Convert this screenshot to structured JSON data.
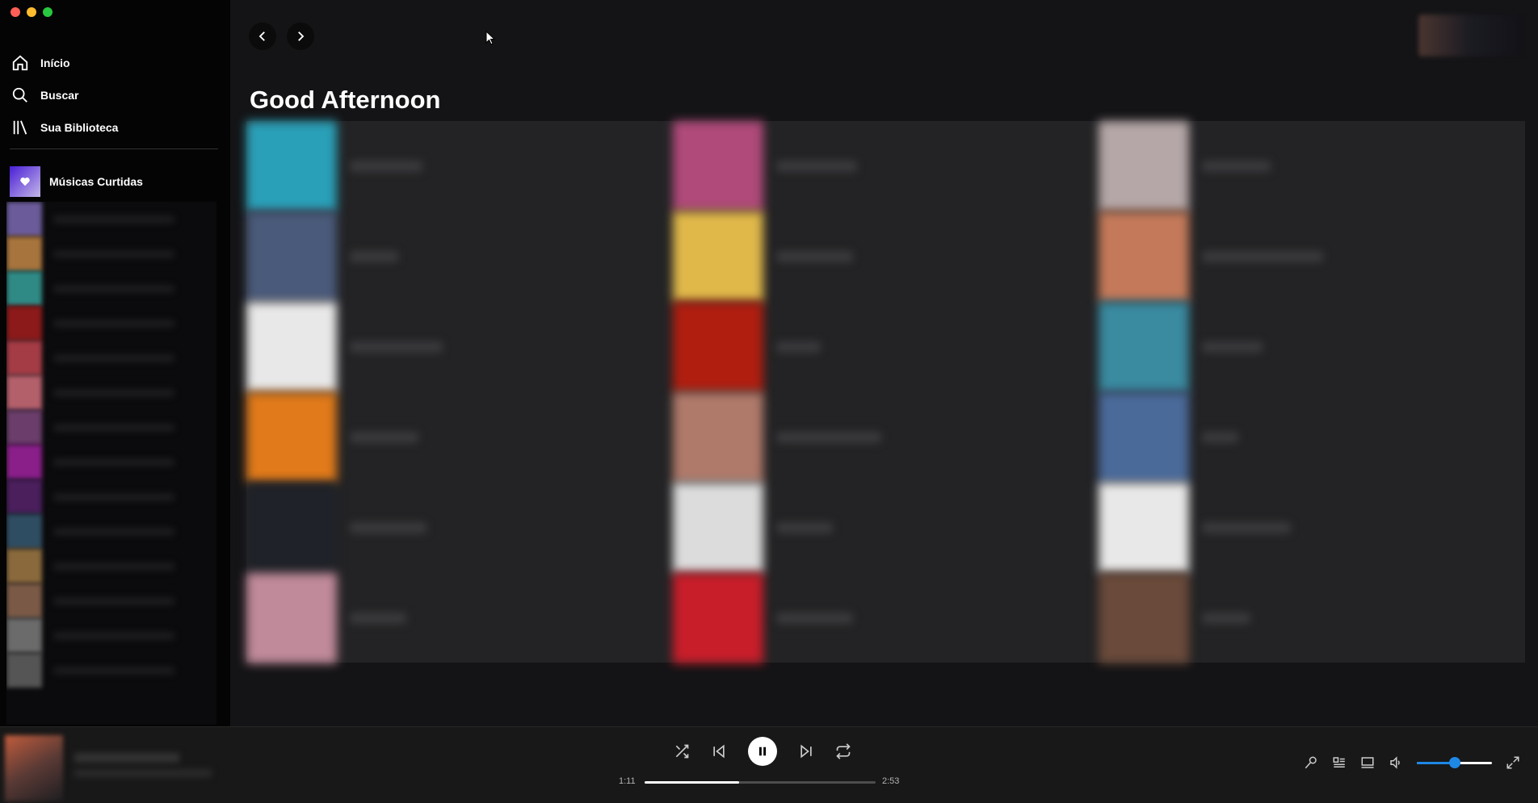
{
  "sidebar": {
    "nav": [
      {
        "label": "Início",
        "icon": "home-icon"
      },
      {
        "label": "Buscar",
        "icon": "search-icon"
      },
      {
        "label": "Sua Biblioteca",
        "icon": "library-icon"
      }
    ],
    "liked_songs": "Músicas Curtidas",
    "playlist_covers": [
      "#6b5b9a",
      "#a8743d",
      "#2f8a85",
      "#8c1a1a",
      "#a43c46",
      "#b4606b",
      "#6a3d6a",
      "#8a1f8a",
      "#4a1f5c",
      "#2f4d62",
      "#8a6a3d",
      "#7a5a46",
      "#6b6b6b",
      "#555"
    ]
  },
  "header": {
    "greeting": "Good Afternoon"
  },
  "grid": {
    "covers": [
      [
        "#2aa0b8",
        "#b04a7a",
        "#b5a7a7"
      ],
      [
        "#4a5a7a",
        "#e0b84a",
        "#c47a5a"
      ],
      [
        "#e8e8e8",
        "#b01e10",
        "#3a8aa0"
      ],
      [
        "#e07a1a",
        "#b07a6a",
        "#4a6a9a"
      ],
      [
        "#1f2228",
        "#dcdcdc",
        "#e8e8e8"
      ],
      [
        "#c08a9a",
        "#c81e2a",
        "#6a4a3a"
      ]
    ]
  },
  "player": {
    "elapsed": "1:11",
    "duration": "2:53",
    "progress": 0.41,
    "volume": 0.5
  },
  "colors": {
    "accent": "#1e88e5",
    "traffic_close": "#ff5f57",
    "traffic_min": "#febc2e",
    "traffic_max": "#28c840"
  }
}
